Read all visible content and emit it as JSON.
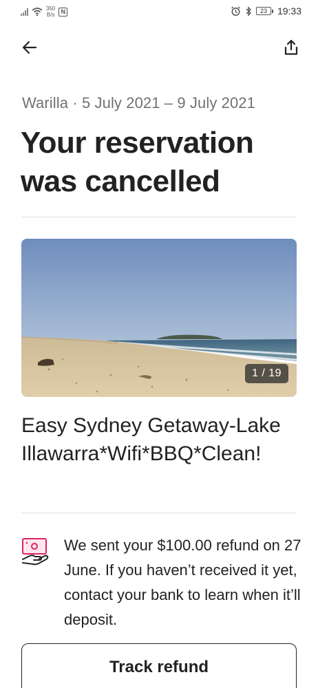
{
  "status_bar": {
    "net_speed_value": "350",
    "net_speed_unit": "B/s",
    "nfc": "N",
    "battery": "23",
    "time": "19:33"
  },
  "header": {
    "back_icon": "arrow-left-icon",
    "share_icon": "share-icon"
  },
  "reservation": {
    "subtitle": "Warilla · 5 July 2021 – 9 July 2021",
    "title": "Your reservation was cancelled"
  },
  "listing": {
    "photo_counter": "1 / 19",
    "title": "Easy Sydney Getaway-Lake Illawarra*Wifi*BBQ*Clean!"
  },
  "refund": {
    "icon": "refund-money-icon",
    "message": "We sent your $100.00 refund on 27 June. If you haven’t received it yet, contact your bank to learn when it’ll deposit.",
    "button_label": "Track refund"
  },
  "colors": {
    "text_primary": "#222222",
    "text_secondary": "#717171",
    "accent_pink": "#E0245E",
    "divider": "#DDDDDD"
  }
}
